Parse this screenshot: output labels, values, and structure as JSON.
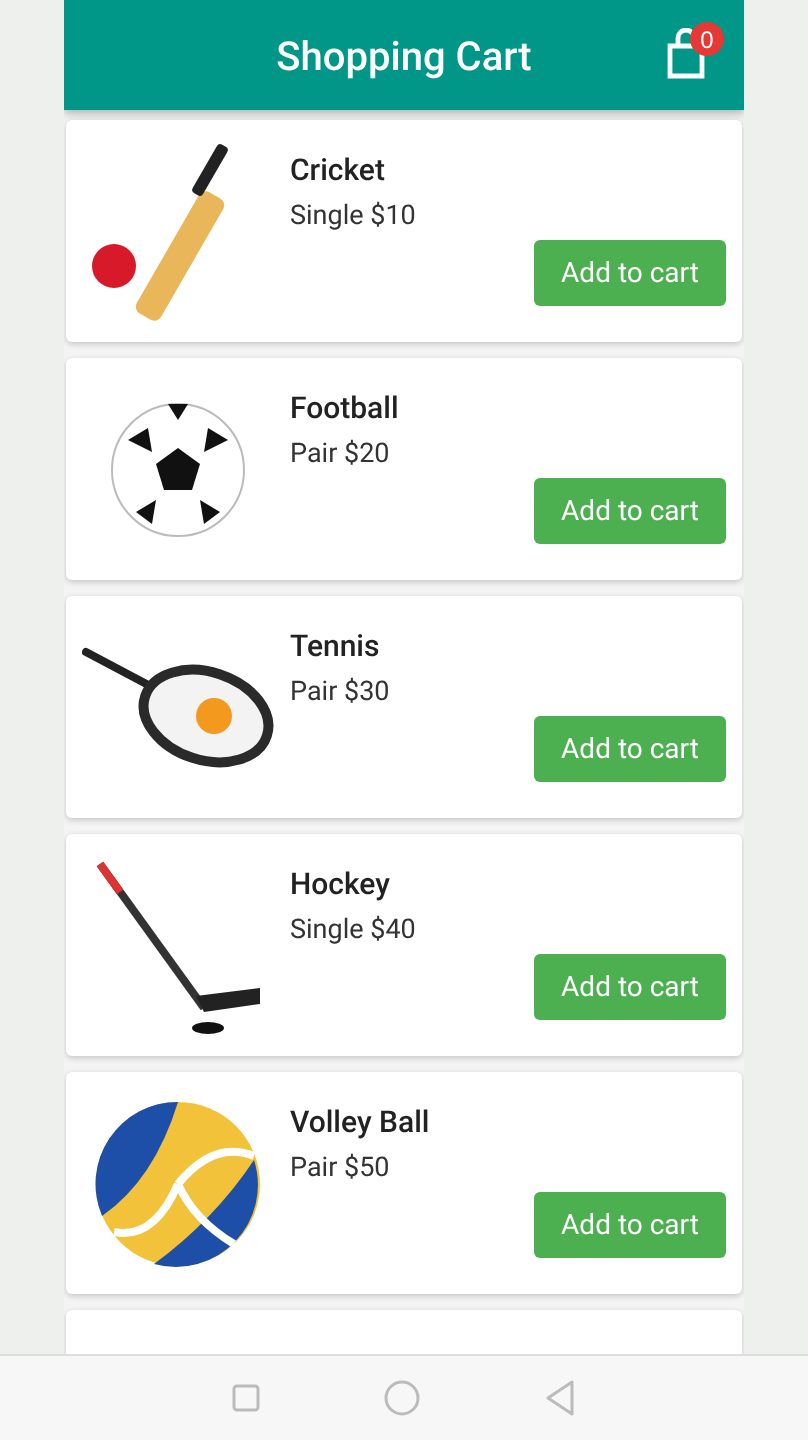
{
  "app_bar": {
    "title": "Shopping Cart",
    "cart_count": "0"
  },
  "products": [
    {
      "kind": "cricket",
      "name": "Cricket",
      "price": "Single $10",
      "button": "Add to cart"
    },
    {
      "kind": "football",
      "name": "Football",
      "price": "Pair $20",
      "button": "Add to cart"
    },
    {
      "kind": "tennis",
      "name": "Tennis",
      "price": "Pair $30",
      "button": "Add to cart"
    },
    {
      "kind": "hockey",
      "name": "Hockey",
      "price": "Single $40",
      "button": "Add to cart"
    },
    {
      "kind": "volleyball",
      "name": "Volley Ball",
      "price": "Pair $50",
      "button": "Add to cart"
    }
  ]
}
